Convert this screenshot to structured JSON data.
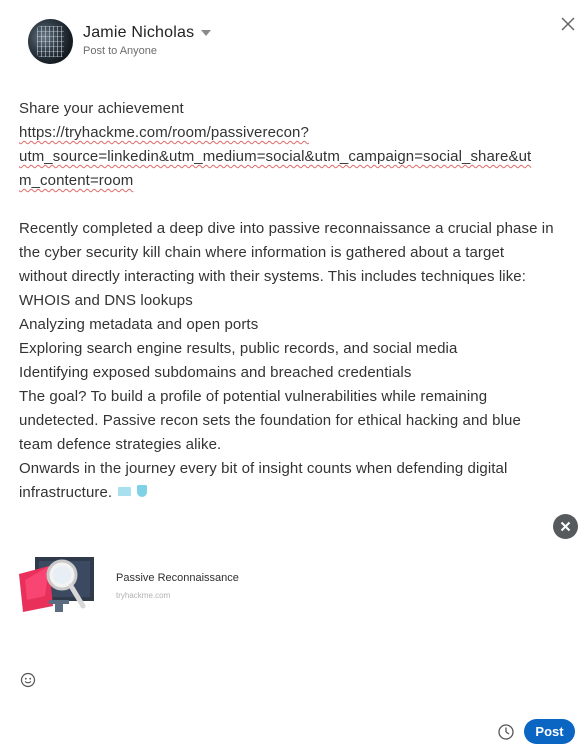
{
  "author": {
    "name": "Jamie Nicholas",
    "audience": "Post to Anyone"
  },
  "post": {
    "lines": [
      "Share your achievement",
      "https://tryhackme.com/room/passiverecon?",
      "utm_source=linkedin&utm_medium=social&utm_campaign=social_share&ut",
      "m_content=room",
      "",
      "Recently completed a deep dive into passive reconnaissance a crucial phase in",
      "the cyber security kill chain where information is gathered about a target",
      "without directly interacting with their systems. This includes techniques like:",
      "WHOIS and DNS lookups",
      "Analyzing metadata and open ports",
      "Exploring search engine results, public records, and social media",
      "Identifying exposed subdomains and breached credentials",
      "The goal? To build a profile of potential vulnerabilities while remaining",
      "undetected. Passive recon sets the foundation for ethical hacking and blue",
      "team defence strategies alike.",
      "Onwards in the journey every bit of insight counts when defending digital",
      "infrastructure."
    ]
  },
  "link_preview": {
    "title": "Passive Reconnaissance",
    "domain": "tryhackme.com"
  },
  "actions": {
    "post_label": "Post"
  },
  "colors": {
    "primary": "#0a66c2",
    "spellcheck": "#e06a6a"
  },
  "icons": [
    "close-icon",
    "chevron-down-icon",
    "folder-emoji",
    "shield-emoji",
    "remove-preview-icon",
    "emoji-icon",
    "clock-icon"
  ]
}
